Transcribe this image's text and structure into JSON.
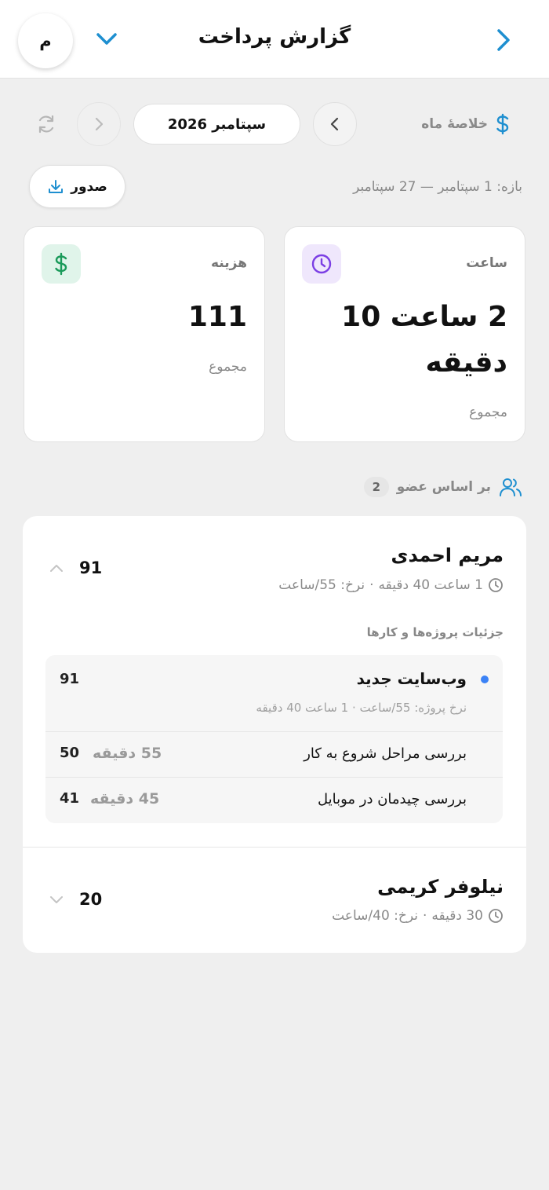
{
  "header": {
    "avatar_letter": "م",
    "title": "گزارش پرداخت"
  },
  "summary": {
    "label": "خلاصهٔ ماه",
    "month": "سپتامبر 2026",
    "range": "بازه: 1 سپتامبر — 27 سپتامبر",
    "export_label": "صدور"
  },
  "stats": {
    "hours": {
      "label": "ساعت",
      "value_line1": "2 ساعت 10",
      "value_line2": "دقیقه",
      "sub": "مجموع"
    },
    "cost": {
      "label": "هزینه",
      "value": "111",
      "sub": "مجموع"
    }
  },
  "members_section": {
    "label": "بر اساس عضو",
    "count": "2"
  },
  "members": [
    {
      "name": "مریم احمدی",
      "duration": "1 ساعت 40 دقیقه",
      "rate": "نرخ: 55/ساعت",
      "total": "91",
      "details_title": "جزئیات پروژه‌ها و کارها",
      "project": {
        "name": "وب‌سایت جدید",
        "meta": "نرخ پروژه: 55/ساعت · 1 ساعت 40 دقیقه",
        "total": "91",
        "tasks": [
          {
            "name": "بررسی مراحل شروع به کار",
            "duration": "55 دقیقه",
            "amount": "50"
          },
          {
            "name": "بررسی چیدمان در موبایل",
            "duration": "45 دقیقه",
            "amount": "41"
          }
        ]
      }
    },
    {
      "name": "نیلوفر کریمی",
      "duration": "30 دقیقه",
      "rate": "نرخ: 40/ساعت",
      "total": "20"
    }
  ],
  "colors": {
    "accent": "#1e8fd0",
    "purple": "#7b3fe4",
    "green": "#1a9a5a",
    "dot": "#3b82f6"
  }
}
